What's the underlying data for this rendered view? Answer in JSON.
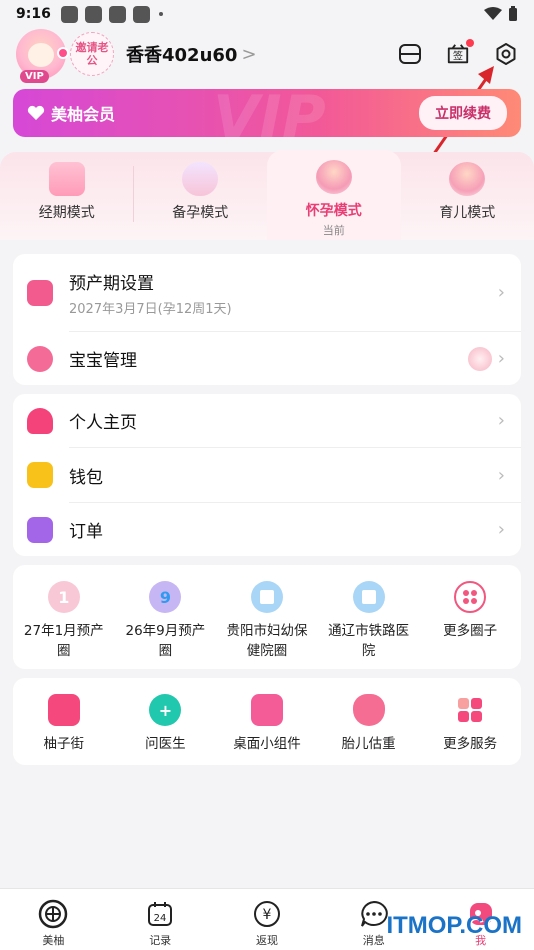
{
  "status_bar": {
    "time": "9:16"
  },
  "header": {
    "vip_badge": "VIP",
    "invite_label": "邀请老公",
    "username": "香香402u60",
    "username_chevron": ">",
    "icons": [
      "layout-icon",
      "sign-in-icon",
      "settings-icon"
    ],
    "sign_label": "签"
  },
  "vip_bar": {
    "title": "美柚会员",
    "watermark": "VIP",
    "renew_label": "立即续费"
  },
  "modes": [
    {
      "label": "经期模式",
      "sub": ""
    },
    {
      "label": "备孕模式",
      "sub": ""
    },
    {
      "label": "怀孕模式",
      "sub": "当前"
    },
    {
      "label": "育儿模式",
      "sub": ""
    }
  ],
  "pregnancy_card": {
    "due_date": {
      "title": "预产期设置",
      "sub": "2027年3月7日(孕12周1天)"
    },
    "baby": {
      "title": "宝宝管理"
    }
  },
  "account_card": {
    "items": [
      {
        "title": "个人主页"
      },
      {
        "title": "钱包"
      },
      {
        "title": "订单"
      }
    ]
  },
  "circles": [
    {
      "label": "27年1月预产圈"
    },
    {
      "label": "26年9月预产圈"
    },
    {
      "label": "贵阳市妇幼保健院圈"
    },
    {
      "label": "通辽市铁路医院"
    },
    {
      "label": "更多圈子"
    }
  ],
  "services": [
    {
      "label": "柚子街"
    },
    {
      "label": "问医生"
    },
    {
      "label": "桌面小组件"
    },
    {
      "label": "胎儿估重"
    },
    {
      "label": "更多服务"
    }
  ],
  "tabbar": [
    {
      "label": "美柚"
    },
    {
      "label": "记录",
      "badge": "24"
    },
    {
      "label": "返现"
    },
    {
      "label": "消息"
    },
    {
      "label": "我"
    }
  ],
  "site_watermark": "ITMOP.COM",
  "colors": {
    "accent": "#e93d75",
    "vip_start": "#d648d7",
    "vip_end": "#ff8a76"
  }
}
